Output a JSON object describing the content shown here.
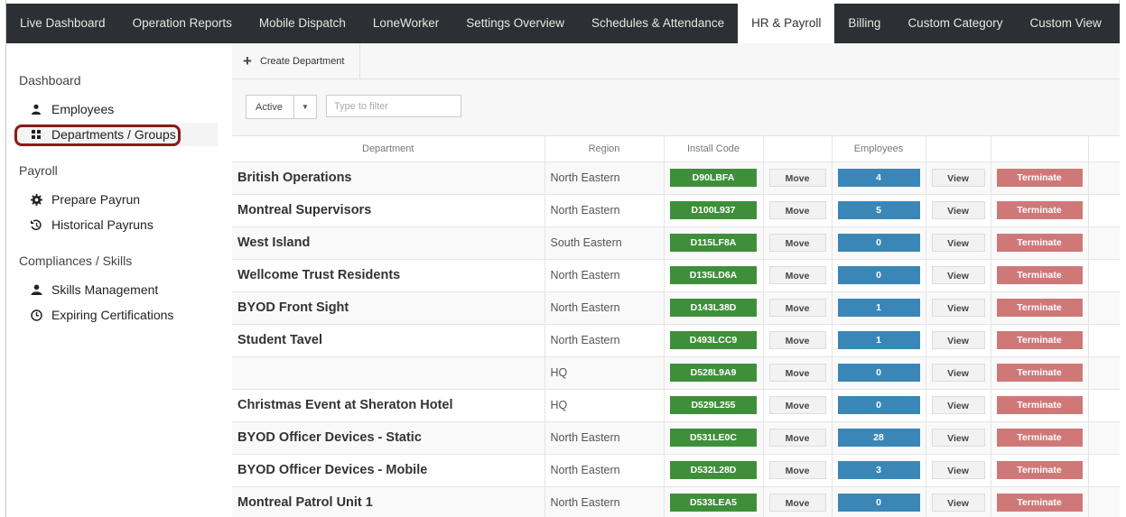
{
  "nav": {
    "items": [
      "Live Dashboard",
      "Operation Reports",
      "Mobile Dispatch",
      "LoneWorker",
      "Settings Overview",
      "Schedules & Attendance",
      "HR & Payroll",
      "Billing",
      "Custom Category",
      "Custom View"
    ],
    "active": "HR & Payroll"
  },
  "sidebar": {
    "dashboard_title": "Dashboard",
    "employees": "Employees",
    "departments": "Departments / Groups",
    "payroll_title": "Payroll",
    "prepare_payrun": "Prepare Payrun",
    "historical_payruns": "Historical Payruns",
    "compliance_title": "Compliances / Skills",
    "skills_management": "Skills Management",
    "expiring_certifications": "Expiring Certifications",
    "highlight_color": "#8b1a1a"
  },
  "toolbar": {
    "create_label": "Create Department"
  },
  "filter": {
    "status_value": "Active",
    "placeholder": "Type to filter"
  },
  "table": {
    "headers": {
      "department": "Department",
      "region": "Region",
      "install_code": "Install Code",
      "employees": "Employees"
    },
    "move_label": "Move",
    "view_label": "View",
    "terminate_label": "Terminate",
    "rows": [
      {
        "name": "British Operations",
        "region": "North Eastern",
        "code": "D90LBFA",
        "employees": "4"
      },
      {
        "name": "Montreal Supervisors",
        "region": "North Eastern",
        "code": "D100L937",
        "employees": "5"
      },
      {
        "name": "West Island",
        "region": "South Eastern",
        "code": "D115LF8A",
        "employees": "0"
      },
      {
        "name": "Wellcome Trust Residents",
        "region": "North Eastern",
        "code": "D135LD6A",
        "employees": "0"
      },
      {
        "name": "BYOD Front Sight",
        "region": "North Eastern",
        "code": "D143L38D",
        "employees": "1"
      },
      {
        "name": "Student Tavel",
        "region": "North Eastern",
        "code": "D493LCC9",
        "employees": "1"
      },
      {
        "name": "",
        "region": "HQ",
        "code": "D528L9A9",
        "employees": "0"
      },
      {
        "name": "Christmas Event at Sheraton Hotel",
        "region": "HQ",
        "code": "D529L255",
        "employees": "0"
      },
      {
        "name": "BYOD Officer Devices - Static",
        "region": "North Eastern",
        "code": "D531LE0C",
        "employees": "28"
      },
      {
        "name": "BYOD Officer Devices - Mobile",
        "region": "North Eastern",
        "code": "D532L28D",
        "employees": "3"
      },
      {
        "name": "Montreal Patrol Unit 1",
        "region": "North Eastern",
        "code": "D533LEA5",
        "employees": "0"
      }
    ]
  },
  "colors": {
    "nav_bg": "#2c2f33",
    "code_green": "#3f8f3a",
    "employee_blue": "#3a87b7",
    "terminate_red": "#cf7878"
  }
}
